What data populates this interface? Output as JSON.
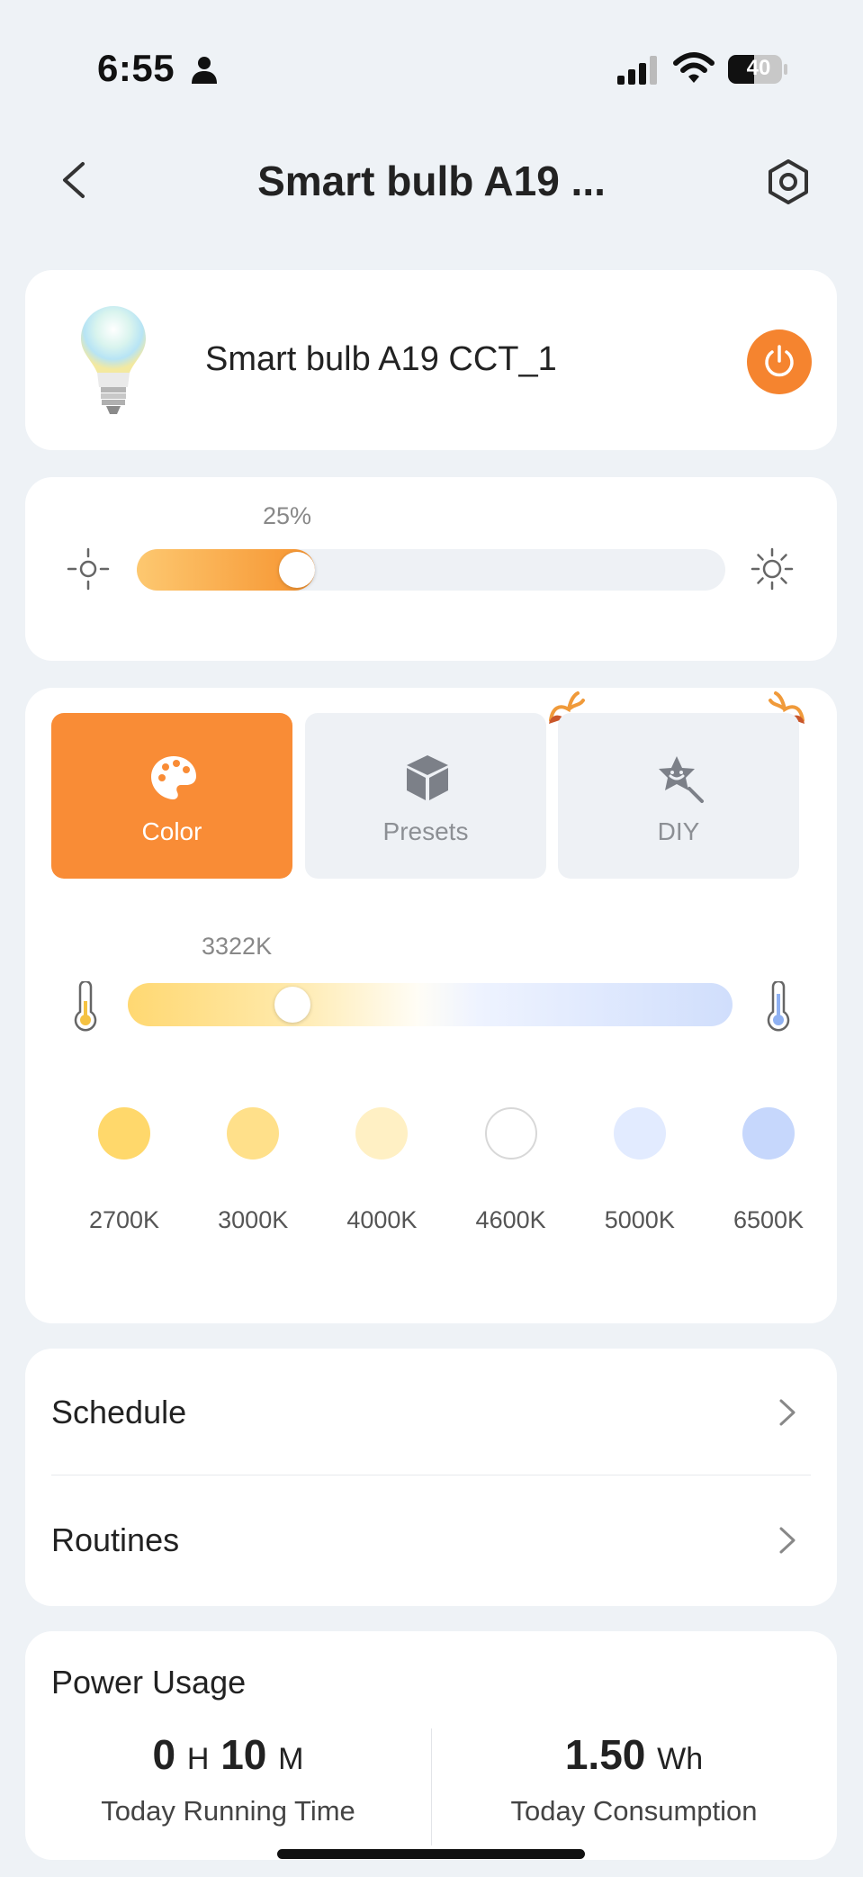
{
  "status_bar": {
    "time": "6:55",
    "battery": "40"
  },
  "header": {
    "title": "Smart bulb A19 ..."
  },
  "device": {
    "name": "Smart bulb A19 CCT_1",
    "power_on": true,
    "accent_color": "#f5842f"
  },
  "brightness": {
    "label": "25%",
    "percent": 25
  },
  "modes": {
    "tabs": [
      {
        "label": "Color",
        "icon": "palette-icon",
        "active": true
      },
      {
        "label": "Presets",
        "icon": "cube-icon",
        "active": false
      },
      {
        "label": "DIY",
        "icon": "star-wand-icon",
        "active": false
      }
    ]
  },
  "color_temp": {
    "label": "3322K",
    "value_k": 3322,
    "min_k": 2700,
    "max_k": 6500,
    "presets": [
      {
        "label": "2700K",
        "color": "#ffd86b"
      },
      {
        "label": "3000K",
        "color": "#ffe08a"
      },
      {
        "label": "4000K",
        "color": "#fff0c4"
      },
      {
        "label": "4600K",
        "color": "#ffffff"
      },
      {
        "label": "5000K",
        "color": "#e2ebff"
      },
      {
        "label": "6500K",
        "color": "#c6d7fc"
      }
    ]
  },
  "links": {
    "schedule": "Schedule",
    "routines": "Routines"
  },
  "power_usage": {
    "title": "Power Usage",
    "running_hours": "0",
    "hours_unit": "H",
    "running_minutes": "10",
    "minutes_unit": "M",
    "running_caption": "Today Running Time",
    "consumption": "1.50",
    "consumption_unit": "Wh",
    "consumption_caption": "Today Consumption"
  }
}
